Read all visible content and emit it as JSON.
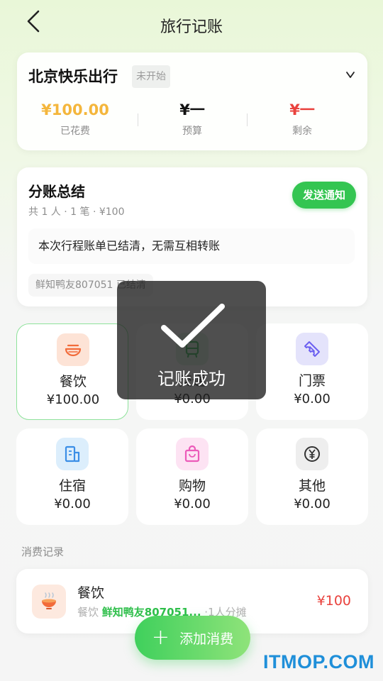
{
  "header": {
    "title": "旅行记账"
  },
  "trip": {
    "name": "北京快乐出行",
    "status": "未开始",
    "stats": [
      {
        "value": "¥100.00",
        "label": "已花费",
        "color": "#f4b63c"
      },
      {
        "value": "¥一",
        "label": "预算",
        "color": "#111111"
      },
      {
        "value": "¥一",
        "label": "剩余",
        "color": "#e9423d"
      }
    ]
  },
  "settlement": {
    "title": "分账总结",
    "subtitle": "共 1 人 · 1 笔 · ¥100",
    "notify_label": "发送通知",
    "message": "本次行程账单已结清，无需互相转账",
    "member_status": "鲜知鸭友807051 已结清"
  },
  "categories": [
    {
      "name": "餐饮",
      "amount": "¥100.00",
      "icon": "noodle-bowl-icon",
      "bg": "#fde3d6",
      "fg": "#f26b3a"
    },
    {
      "name": "交通",
      "amount": "¥0.00",
      "icon": "bus-icon",
      "bg": "#dff6e3",
      "fg": "#3bbf5a"
    },
    {
      "name": "门票",
      "amount": "¥0.00",
      "icon": "ticket-icon",
      "bg": "#e4e3fb",
      "fg": "#6b5ff0"
    },
    {
      "name": "住宿",
      "amount": "¥0.00",
      "icon": "building-icon",
      "bg": "#dceefc",
      "fg": "#3b8ee6"
    },
    {
      "name": "购物",
      "amount": "¥0.00",
      "icon": "shopping-bag-icon",
      "bg": "#fde3f3",
      "fg": "#ec5ab9"
    },
    {
      "name": "其他",
      "amount": "¥0.00",
      "icon": "yen-coin-icon",
      "bg": "#eeeeee",
      "fg": "#333333"
    }
  ],
  "records": {
    "label": "消费记录",
    "items": [
      {
        "title": "餐饮",
        "category": "餐饮",
        "payer": "鲜知鸭友807051...",
        "split": "·1人分摊",
        "amount": "¥100"
      }
    ]
  },
  "add_button": {
    "label": "添加消费"
  },
  "toast": {
    "text": "记账成功"
  },
  "watermark": "ITMOP.COM"
}
